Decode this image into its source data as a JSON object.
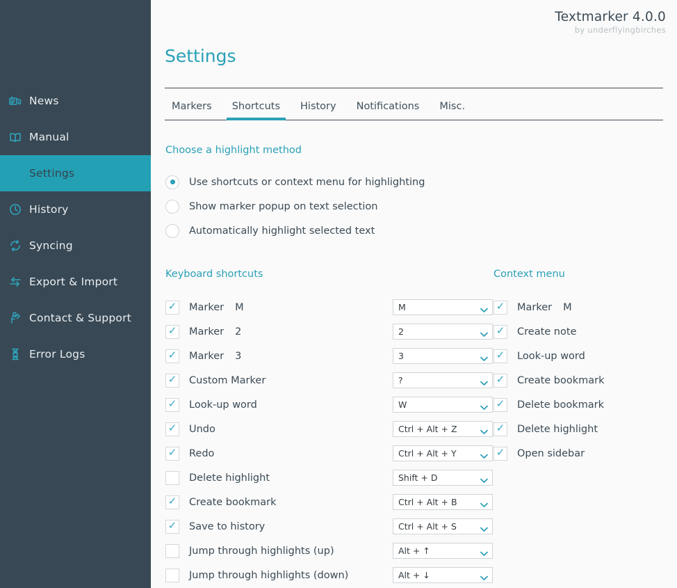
{
  "brand": {
    "title": "Textmarker 4.0.0",
    "subtitle": "by underflyingbirches"
  },
  "sidebar": {
    "items": [
      {
        "label": "News",
        "icon": "news-icon",
        "active": false
      },
      {
        "label": "Manual",
        "icon": "book-icon",
        "active": false
      },
      {
        "label": "Settings",
        "icon": "none",
        "active": true
      },
      {
        "label": "History",
        "icon": "clock-icon",
        "active": false
      },
      {
        "label": "Syncing",
        "icon": "sync-icon",
        "active": false
      },
      {
        "label": "Export & Import",
        "icon": "exchange-icon",
        "active": false
      },
      {
        "label": "Contact & Support",
        "icon": "support-icon",
        "active": false
      },
      {
        "label": "Error Logs",
        "icon": "bug-icon",
        "active": false
      }
    ]
  },
  "page": {
    "title": "Settings"
  },
  "tabs": [
    {
      "label": "Markers",
      "active": false
    },
    {
      "label": "Shortcuts",
      "active": true
    },
    {
      "label": "History",
      "active": false
    },
    {
      "label": "Notifications",
      "active": false
    },
    {
      "label": "Misc.",
      "active": false
    }
  ],
  "highlight_method": {
    "heading": "Choose a highlight method",
    "options": [
      {
        "label": "Use shortcuts or context menu for highlighting",
        "selected": true
      },
      {
        "label": "Show marker popup on text selection",
        "selected": false
      },
      {
        "label": "Automatically highlight selected text",
        "selected": false
      }
    ]
  },
  "keyboard_shortcuts": {
    "heading": "Keyboard shortcuts",
    "rows": [
      {
        "label": "Marker",
        "suffix": "M",
        "checked": true,
        "value": "M"
      },
      {
        "label": "Marker",
        "suffix": "2",
        "checked": true,
        "value": "2"
      },
      {
        "label": "Marker",
        "suffix": "3",
        "checked": true,
        "value": "3"
      },
      {
        "label": "Custom Marker",
        "suffix": "",
        "checked": true,
        "value": "?"
      },
      {
        "label": "Look-up word",
        "suffix": "",
        "checked": true,
        "value": "W"
      },
      {
        "label": "Undo",
        "suffix": "",
        "checked": true,
        "value": "Ctrl + Alt + Z"
      },
      {
        "label": "Redo",
        "suffix": "",
        "checked": true,
        "value": "Ctrl + Alt + Y"
      },
      {
        "label": "Delete highlight",
        "suffix": "",
        "checked": false,
        "value": "Shift + D"
      },
      {
        "label": "Create bookmark",
        "suffix": "",
        "checked": true,
        "value": "Ctrl + Alt + B"
      },
      {
        "label": "Save to history",
        "suffix": "",
        "checked": true,
        "value": "Ctrl + Alt + S"
      },
      {
        "label": "Jump through highlights (up)",
        "suffix": "",
        "checked": false,
        "value": "Alt + ↑"
      },
      {
        "label": "Jump through highlights (down)",
        "suffix": "",
        "checked": false,
        "value": "Alt + ↓"
      }
    ]
  },
  "context_menu": {
    "heading": "Context menu",
    "rows": [
      {
        "label": "Marker",
        "suffix": "M",
        "checked": true
      },
      {
        "label": "Create note",
        "suffix": "",
        "checked": true
      },
      {
        "label": "Look-up word",
        "suffix": "",
        "checked": true
      },
      {
        "label": "Create bookmark",
        "suffix": "",
        "checked": true
      },
      {
        "label": "Delete bookmark",
        "suffix": "",
        "checked": true
      },
      {
        "label": "Delete highlight",
        "suffix": "",
        "checked": true
      },
      {
        "label": "Open sidebar",
        "suffix": "",
        "checked": true
      }
    ]
  },
  "colors": {
    "accent": "#2aa0b6",
    "sidebar_bg": "#384854",
    "sidebar_active": "#24a0b5",
    "page_bg": "#fafafa",
    "text": "#3b4a55"
  },
  "icons": {
    "checkmark": "✓",
    "chevron_down": "chevron-down-icon"
  }
}
